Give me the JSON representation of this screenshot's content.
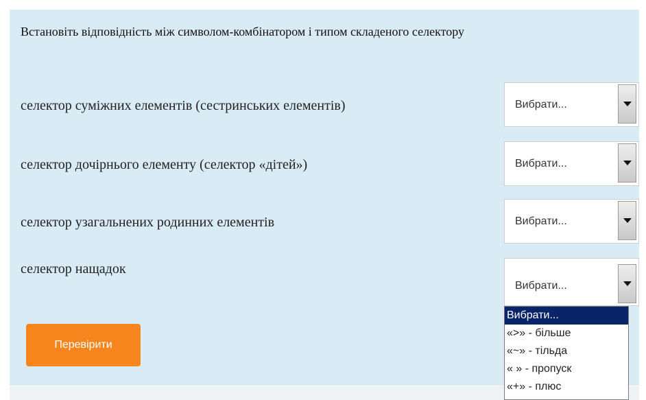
{
  "question": {
    "text": "Встановіть відповідність між символом-комбінатором і типом складеного селектору",
    "rows": [
      {
        "label": "селектор суміжних елементів (сестринських елементів)",
        "selected": "Вибрати..."
      },
      {
        "label": "селектор дочірнього елементу (селектор «дітей»)",
        "selected": "Вибрати..."
      },
      {
        "label": "селектор узагальнених родинних елементів",
        "selected": "Вибрати..."
      },
      {
        "label": "селектор нащадок",
        "selected": "Вибрати..."
      }
    ]
  },
  "dropdown": {
    "options": [
      "Вибрати...",
      "«>» - більше",
      "«~» - тільда",
      "« » - пропуск",
      "«+» - плюс"
    ],
    "highlighted_index": 0
  },
  "check_button": {
    "label": "Перевірити"
  },
  "colors": {
    "panel_background": "#d9ebf5",
    "button_orange": "#f7851d",
    "option_highlight": "#0a246a"
  },
  "icons": {
    "select_arrow": "chevron-down-icon"
  }
}
